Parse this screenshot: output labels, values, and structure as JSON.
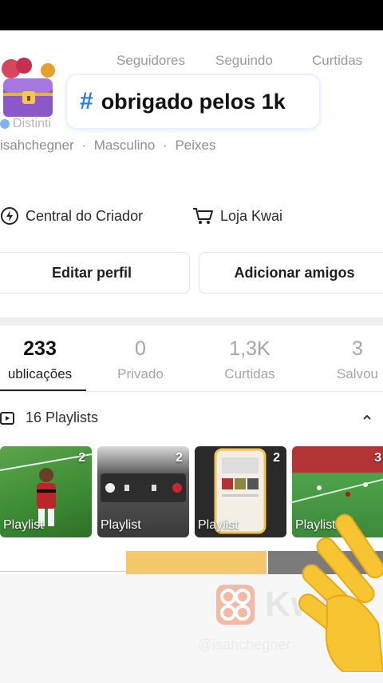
{
  "profile": {
    "stat_labels": [
      "Seguidores",
      "Seguindo",
      "Curtidas"
    ],
    "banner_hashtag": "#",
    "banner_text": "obrigado pelos 1k",
    "verified_text": "Distinti",
    "meta": [
      "isahchegner",
      "·",
      "Masculino",
      "·",
      "Peixes"
    ]
  },
  "quick_links": {
    "creator_center": "Central do Criador",
    "kwai_shop": "Loja Kwai"
  },
  "actions": {
    "edit_profile": "Editar perfil",
    "add_friends": "Adicionar amigos"
  },
  "tabs": [
    {
      "count": "233",
      "label": "ublicações"
    },
    {
      "count": "0",
      "label": "Privado"
    },
    {
      "count": "1,3K",
      "label": "Curtidas"
    },
    {
      "count": "3",
      "label": "Salvou"
    }
  ],
  "playlists": {
    "header": "16 Playlists",
    "items": [
      {
        "count": "2",
        "label": "Playlist"
      },
      {
        "count": "2",
        "label": "Playlist"
      },
      {
        "count": "2",
        "label": "Playlist"
      },
      {
        "count": "3",
        "label": "Playlist"
      }
    ]
  },
  "watermark": {
    "brand": "Kwai",
    "handle": "@isahchegner"
  },
  "colors": {
    "accent_blue": "#2b7be4",
    "hand_yellow": "#f7c531"
  }
}
